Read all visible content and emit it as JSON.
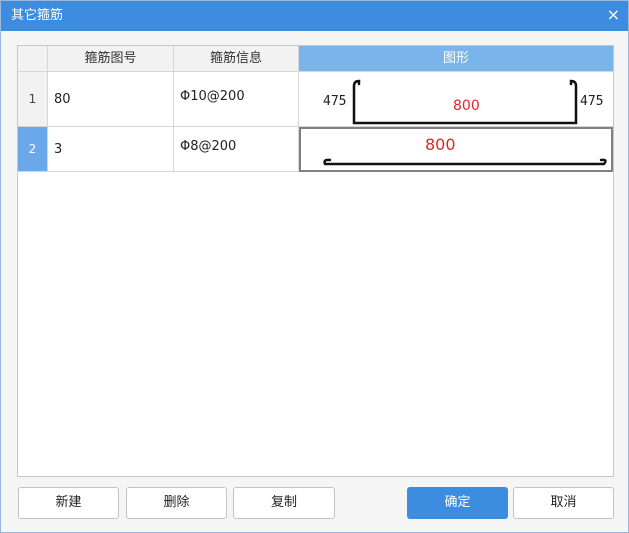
{
  "window": {
    "title": "其它箍筋",
    "close_glyph": "×"
  },
  "grid": {
    "columns": [
      "箍筋图号",
      "箍筋信息",
      "图形"
    ],
    "rows": [
      {
        "num": "1",
        "figure_no": "80",
        "info": "Φ10@200",
        "shape": {
          "left_label": "475",
          "right_label": "475",
          "length": "800"
        }
      },
      {
        "num": "2",
        "figure_no": "3",
        "info": "Φ8@200",
        "shape": {
          "length": "800"
        }
      }
    ],
    "selected_row": 2
  },
  "buttons": {
    "new": "新建",
    "delete": "删除",
    "copy": "复制",
    "ok": "确定",
    "cancel": "取消"
  },
  "colors": {
    "title_bar": "#3c8ce0",
    "selected_header": "#7ab4ea",
    "dimension_text": "#e0262a"
  }
}
